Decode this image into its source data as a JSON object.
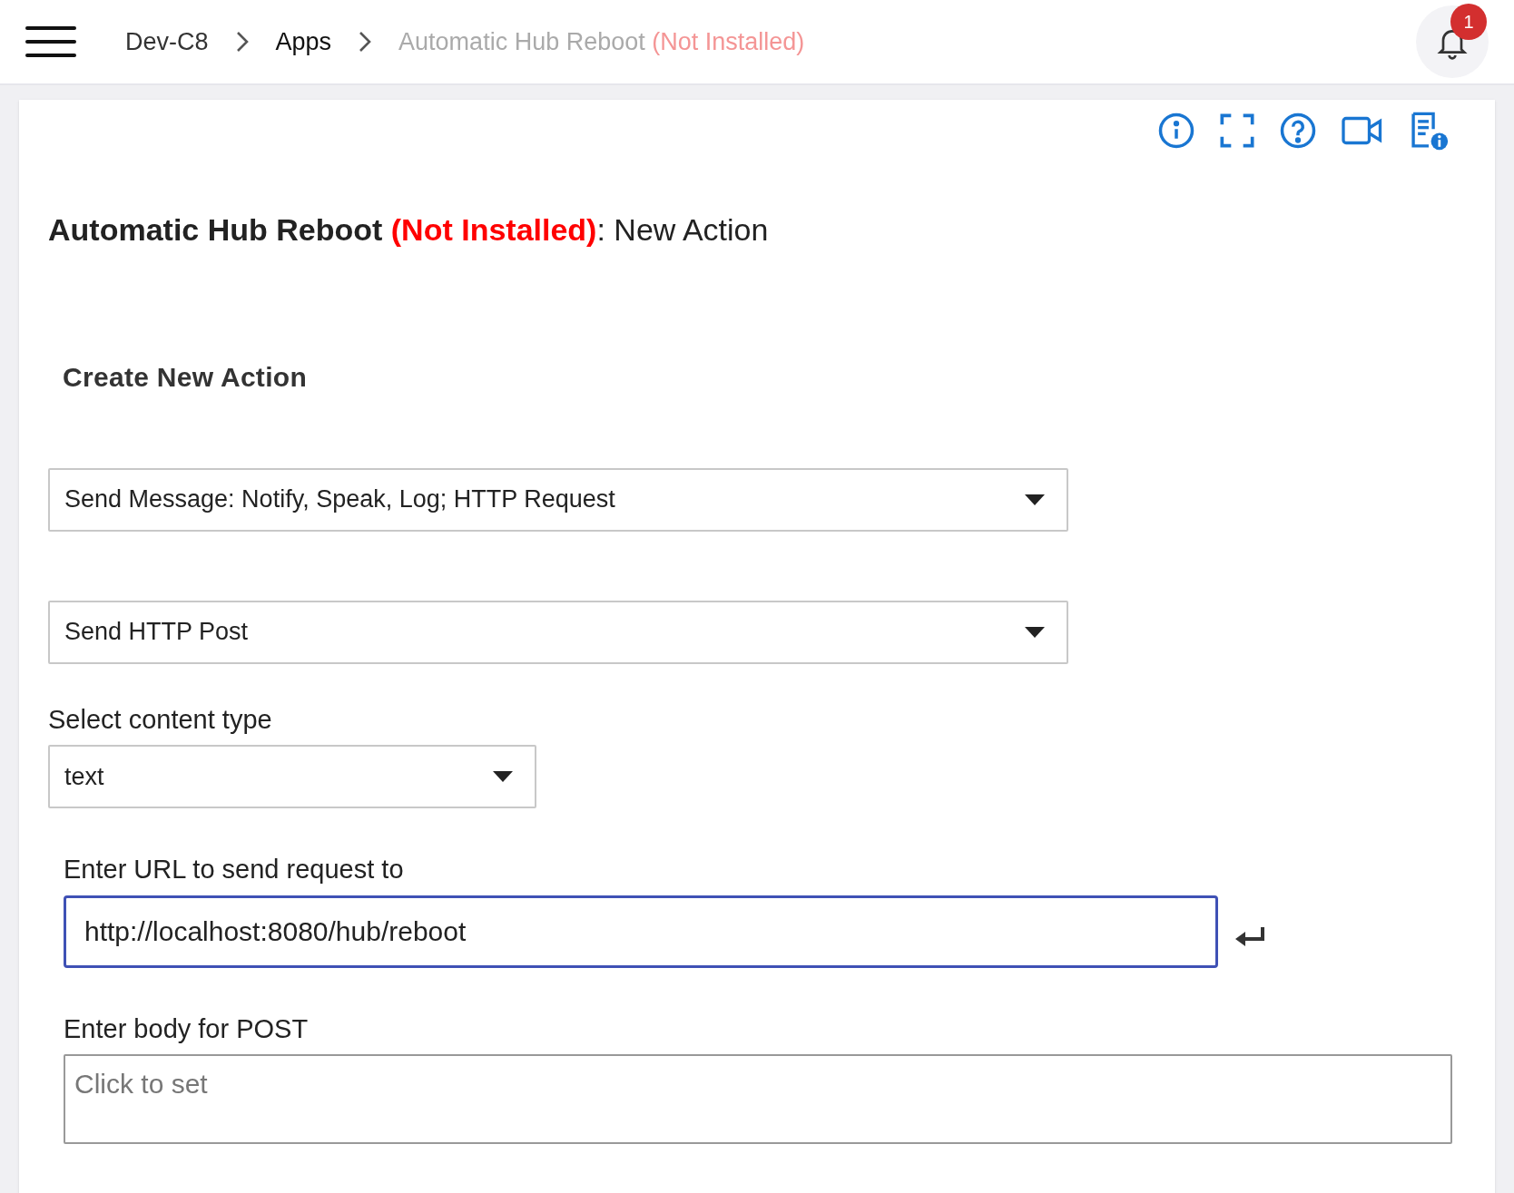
{
  "breadcrumbs": [
    {
      "label": "Dev-C8"
    },
    {
      "label": "Apps"
    }
  ],
  "current_page": {
    "name": "Automatic Hub Reboot",
    "status": "(Not Installed)"
  },
  "notifications": {
    "count": "1"
  },
  "title": {
    "name": "Automatic Hub Reboot",
    "status": "(Not Installed)",
    "suffix": ": New Action"
  },
  "section_heading": "Create New Action",
  "fields": [
    {
      "kind": "select",
      "value": "Send Message: Notify, Speak, Log; HTTP Request"
    },
    {
      "kind": "select",
      "value": "Send HTTP Post"
    },
    {
      "kind": "short_select",
      "label": "Select content type",
      "value": "text"
    },
    {
      "kind": "text",
      "label": "Enter URL to send request to",
      "value": "http://localhost:8080/hub/reboot",
      "focused": true
    },
    {
      "kind": "textarea",
      "label": "Enter body for POST",
      "placeholder": "Click to set"
    }
  ]
}
